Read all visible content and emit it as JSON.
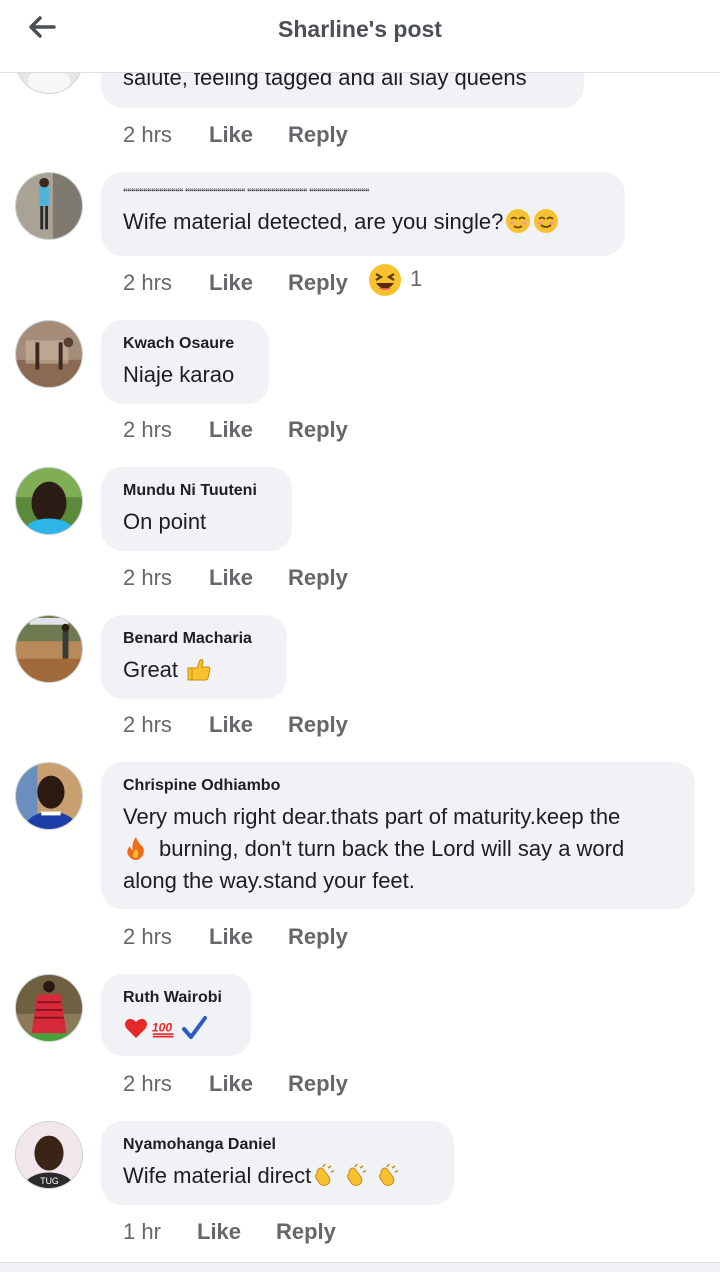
{
  "header": {
    "title": "Sharline's post",
    "back_icon": "arrow-left-icon"
  },
  "actions": {
    "like": "Like",
    "reply": "Reply"
  },
  "comments": [
    {
      "author": "",
      "line1": "salute, feeling tagged and all slay queens",
      "time": "2 hrs"
    },
    {
      "author": "",
      "line0": "“““““““““““““““ “““““““““““““““ “““““““““““““““ “““““““““““““““",
      "line1": "Wife material detected, are you single?",
      "time": "2 hrs",
      "reaction_icon": "laughing-emoji-icon",
      "reaction_count": "1"
    },
    {
      "author": "Kwach Osaure",
      "line1": "Niaje karao",
      "time": "2 hrs"
    },
    {
      "author": "Mundu Ni Tuuteni",
      "line1": "On point",
      "time": "2 hrs"
    },
    {
      "author": "Benard Macharia",
      "line1": "Great",
      "time": "2 hrs"
    },
    {
      "author": "Chrispine Odhiambo",
      "line1": "Very much right dear.thats part of maturity.keep the",
      "line2": "burning, don't turn back the Lord will say a word",
      "line3": "along the way.stand your feet.",
      "time": "2 hrs"
    },
    {
      "author": "Ruth Wairobi",
      "time": "2 hrs"
    },
    {
      "author": "Nyamohanga Daniel",
      "line1": "Wife material direct",
      "time": "1 hr"
    }
  ],
  "colors": {
    "bubble": "#f0f2f5",
    "meta": "#65676b",
    "text": "#1c1e21",
    "header_title": "#4b4f56"
  }
}
